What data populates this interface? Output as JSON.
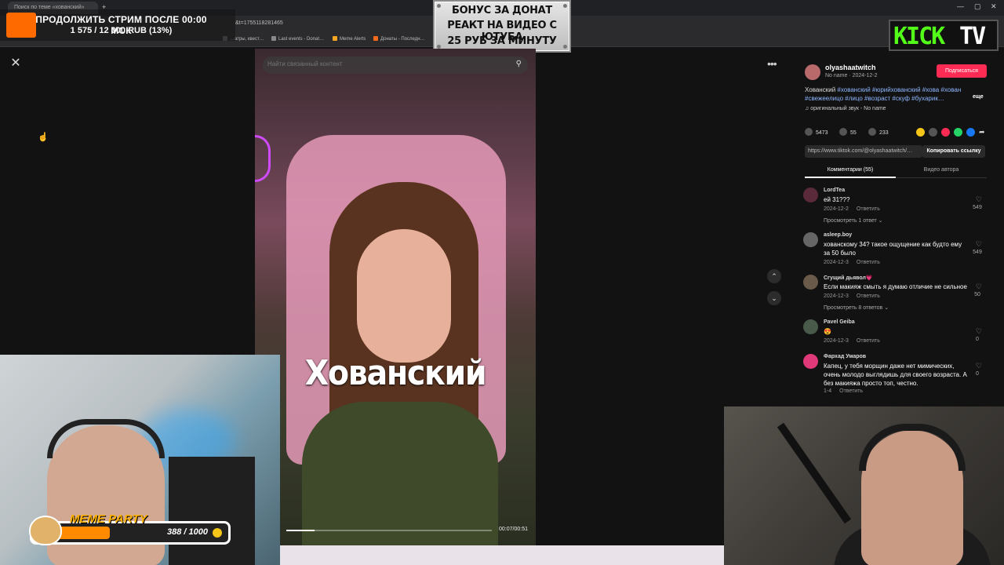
{
  "browser": {
    "tab_title": "Поиск по теме «хованский»",
    "url_fragment": "&t=1755118281465",
    "bookmarks": [
      {
        "label": "…атры, квест…",
        "color": "#666"
      },
      {
        "label": "Last events - Donat…",
        "color": "#888"
      },
      {
        "label": "Meme Alerts",
        "color": "#f5a623"
      },
      {
        "label": "Донаты - Последн…",
        "color": "#f26b1d"
      }
    ],
    "window_controls": [
      "—",
      "▢",
      "✕"
    ]
  },
  "donation_goal": {
    "line1": "ПРОДОЛЖИТЬ СТРИМ ПОСЛЕ 00:00 МСК",
    "line2": "1 575 / 12 000 RUB (13%)",
    "progress_percent": 13
  },
  "bonus_plate": {
    "line1": "БОНУС ЗА ДОНАТ",
    "line2": "РЕАКТ НА ВИДЕО С ЮТУБА",
    "line3": "25 РУБ ЗА МИНУТУ"
  },
  "channel_logo": {
    "kick": "KICK",
    "tv": "TV"
  },
  "viewer": {
    "close_icon": "✕",
    "search_placeholder": "Найти связанный контент",
    "caption": "Хованский",
    "time": "00:07/00:51",
    "progress_fraction": 0.137,
    "more_icon": "•••",
    "nav_up": "⌃",
    "nav_down": "⌄"
  },
  "post": {
    "author": "olyashaatwitch",
    "author_sub": "No name · 2024-12-2",
    "follow_label": "Подписаться",
    "desc_start": "Хованский ",
    "desc_tags": "#хованский #юрийхованский #хова #хован #свежеелицо #лицо #возраст #скуф #бухарик…",
    "more_label": "еще",
    "sound": "♫  оригинальный звук - No name",
    "likes": "5473",
    "comments": "55",
    "saves": "233",
    "link": "https://www.tiktok.com/@olyashaatwitch/…",
    "copy_label": "Копировать ссылку",
    "tab_comments": "Комментарии (55)",
    "tab_author": "Видео автора",
    "share_colors": [
      "#f5c518",
      "#555555",
      "#fe2c55",
      "#25d366",
      "#1877f2"
    ]
  },
  "comments": [
    {
      "name": "LordTea",
      "text": "ей 31???",
      "date": "2024-12-2",
      "reply": "Ответить",
      "likes": "549",
      "more": "Просмотреть 1 ответ ⌄",
      "avatar": "#5a2a3a"
    },
    {
      "name": "asleep.boy",
      "text": "хованскому 34? такое ощущение как будто ему за 50 было",
      "date": "2024-12-3",
      "reply": "Ответить",
      "likes": "549",
      "more": "",
      "avatar": "#666"
    },
    {
      "name": "Сгущий дьявол💗",
      "text": "Если макияж смыть я думаю отличие не сильное",
      "date": "2024-12-3",
      "reply": "Ответить",
      "likes": "50",
      "more": "Просмотреть 8 ответов ⌄",
      "avatar": "#6a5a4a"
    },
    {
      "name": "Pavel Geiba",
      "text": "😍",
      "date": "2024-12-3",
      "reply": "Ответить",
      "likes": "0",
      "more": "",
      "avatar": "#4a5a4a"
    },
    {
      "name": "Фархад Умаров",
      "text": "Капец, у тебя морщин даже нет мимических, очень молодо выглядишь для своего возраста. А без макияжа просто топ, честно.",
      "date": "1-4",
      "reply": "Ответить",
      "likes": "0",
      "more": "",
      "avatar": "#e0397a"
    }
  ],
  "meme_party": {
    "title": "MEME PARTY",
    "count": "388 / 1000",
    "progress_fraction": 0.388
  }
}
